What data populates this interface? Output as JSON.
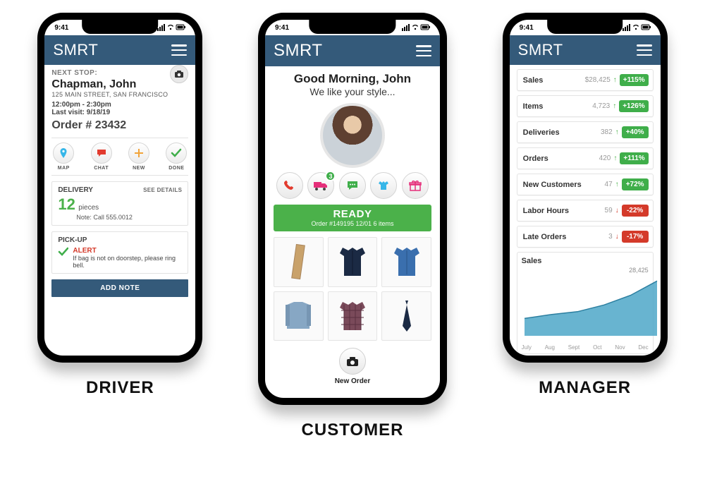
{
  "statusbar": {
    "time": "9:41"
  },
  "appbar": {
    "brand": "SMRT"
  },
  "captions": {
    "driver": "DRIVER",
    "customer": "CUSTOMER",
    "manager": "MANAGER"
  },
  "driver": {
    "next_stop_label": "NEXT STOP:",
    "customer_name": "Chapman, John",
    "address": "125 MAIN STREET, SAN FRANCISCO",
    "time_window": "12:00pm - 2:30pm",
    "last_visit": "Last visit: 9/18/19",
    "order_number": "Order # 23432",
    "actions": {
      "map": "MAP",
      "chat": "CHAT",
      "new": "NEW",
      "done": "DONE"
    },
    "delivery": {
      "title": "DELIVERY",
      "see_details": "SEE DETAILS",
      "pieces_number": "12",
      "pieces_label": "pieces",
      "note": "Note: Call 555.0012"
    },
    "pickup": {
      "title": "PICK-UP",
      "alert_label": "ALERT",
      "instructions": "If bag is not on doorstep, please ring bell."
    },
    "add_note_label": "ADD NOTE"
  },
  "customer": {
    "greeting_line1": "Good Morning, John",
    "greeting_line2": "We like your style...",
    "badge_count": "3",
    "ready": {
      "title": "READY",
      "subtitle": "Order #149195 12/01 6 items"
    },
    "items": [
      {
        "name": "scarf",
        "color": "#c9a26b"
      },
      {
        "name": "blazer",
        "color": "#1b2a44"
      },
      {
        "name": "shirt-blue",
        "color": "#3a6fae"
      },
      {
        "name": "sweater",
        "color": "#87a7c4"
      },
      {
        "name": "shirt-plaid",
        "color": "#7a4a5a"
      },
      {
        "name": "tie",
        "color": "#1b2a44"
      }
    ],
    "new_order_label": "New Order"
  },
  "manager": {
    "kpis": [
      {
        "label": "Sales",
        "value": "$28,425",
        "delta": "+115%",
        "direction": "up"
      },
      {
        "label": "Items",
        "value": "4,723",
        "delta": "+126%",
        "direction": "up"
      },
      {
        "label": "Deliveries",
        "value": "382",
        "delta": "+40%",
        "direction": "up"
      },
      {
        "label": "Orders",
        "value": "420",
        "delta": "+111%",
        "direction": "up"
      },
      {
        "label": "New Customers",
        "value": "47",
        "delta": "+72%",
        "direction": "up"
      },
      {
        "label": "Labor Hours",
        "value": "59",
        "delta": "-22%",
        "direction": "down"
      },
      {
        "label": "Late Orders",
        "value": "3",
        "delta": "-17%",
        "direction": "down"
      }
    ],
    "chart_title": "Sales",
    "chart_max_label": "28,425"
  },
  "chart_data": {
    "type": "area",
    "title": "Sales",
    "xlabel": "",
    "ylabel": "",
    "ylim": [
      0,
      30000
    ],
    "categories": [
      "July",
      "Aug",
      "Sept",
      "Oct",
      "Nov",
      "Dec"
    ],
    "values": [
      9000,
      11000,
      12500,
      16000,
      21000,
      28425
    ]
  }
}
